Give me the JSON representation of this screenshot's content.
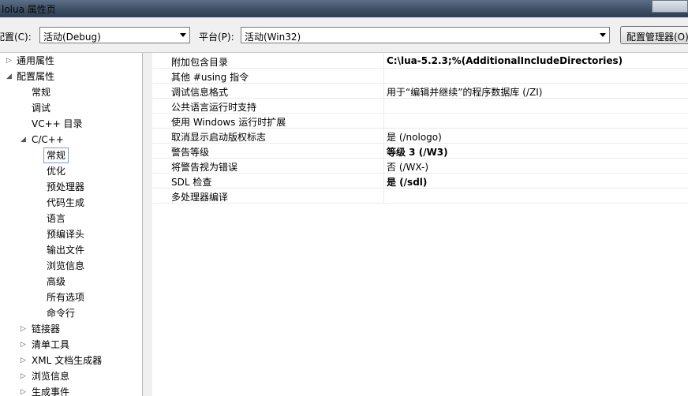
{
  "window": {
    "title": "lolua 属性页"
  },
  "toolbar": {
    "config_label": "配置(C):",
    "config_value": "活动(Debug)",
    "platform_label": "平台(P):",
    "platform_value": "活动(Win32)",
    "config_manager_label": "配置管理器(O)..."
  },
  "tree": {
    "common_props": "通用属性",
    "config_props": "配置属性",
    "general": "常规",
    "debugging": "调试",
    "vc_dirs": "VC++ 目录",
    "cpp": "C/C++",
    "cpp_general": "常规",
    "optimization": "优化",
    "preprocessor": "预处理器",
    "code_generation": "代码生成",
    "language": "语言",
    "precompiled_headers": "预编译头",
    "output_files": "输出文件",
    "browse_info": "浏览信息",
    "advanced": "高级",
    "all_options": "所有选项",
    "command_line": "命令行",
    "linker": "链接器",
    "manifest_tool": "清单工具",
    "xml_doc_generator": "XML 文档生成器",
    "browse_info2": "浏览信息",
    "build_events": "生成事件"
  },
  "props": [
    {
      "name": "附加包含目录",
      "value": "C:\\lua-5.2.3;%(AdditionalIncludeDirectories)",
      "bold": true
    },
    {
      "name": "其他 #using 指令",
      "value": "",
      "bold": false
    },
    {
      "name": "调试信息格式",
      "value": "用于“编辑并继续”的程序数据库 (/ZI)",
      "bold": false
    },
    {
      "name": "公共语言运行时支持",
      "value": "",
      "bold": false
    },
    {
      "name": "使用 Windows 运行时扩展",
      "value": "",
      "bold": false
    },
    {
      "name": "取消显示启动版权标志",
      "value": "是 (/nologo)",
      "bold": false
    },
    {
      "name": "警告等级",
      "value": "等级 3 (/W3)",
      "bold": true
    },
    {
      "name": "将警告视为错误",
      "value": "否 (/WX-)",
      "bold": false
    },
    {
      "name": "SDL 检查",
      "value": "是 (/sdl)",
      "bold": true
    },
    {
      "name": "多处理器编译",
      "value": "",
      "bold": false
    }
  ]
}
